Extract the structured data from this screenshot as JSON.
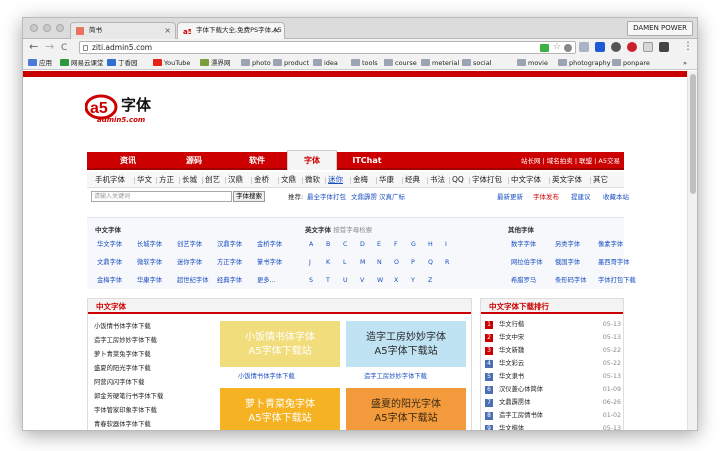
{
  "browser": {
    "tabs": [
      {
        "title": "简书",
        "close": "×"
      },
      {
        "title": "字体下载大全,免费PS字体,A5",
        "close": "×"
      }
    ],
    "profile": "DAMEN POWER",
    "nav_back": "←",
    "nav_forward": "→",
    "nav_reload": "C",
    "url": "ziti.admin5.com",
    "bookmarks": [
      "应用",
      "网易云课堂",
      "丁香园",
      "YouTube",
      "漂界网",
      "photo",
      "product",
      "idea",
      "tools",
      "course",
      "meterial",
      "social",
      "movie",
      "photography",
      "ponpare"
    ],
    "bookmarks_more": "»"
  },
  "site": {
    "logo_text": "字体",
    "logo_mark": "a5",
    "logo_domain": "admin5.com",
    "nav": [
      "资讯",
      "源码",
      "软件",
      "字体",
      "ITChat"
    ],
    "nav_active": 3,
    "nav_right": "站长网 | 域名拍卖 | 联盟 | A5交易",
    "subnav": [
      "手机字体",
      "华文",
      "方正",
      "长城",
      "创艺",
      "汉鼎",
      "金桥",
      "文鼎",
      "微软",
      "迷你",
      "金梅",
      "华康",
      "经典",
      "书法",
      "QQ",
      "字体打包",
      "中文字体",
      "英文字体",
      "其它"
    ],
    "subnav_hi": 9,
    "search_placeholder": "请输入关键词",
    "search_button": "字体搜索",
    "recommend_label": "推荐:",
    "recommend_links": [
      "最全字体打包",
      "文鼎霹雳",
      "汉真广标"
    ],
    "right_links": [
      "最新更新",
      "字体发布",
      "提建议",
      "收藏本站"
    ]
  },
  "categories": {
    "cn_title": "中文字体",
    "cn_items": [
      "华文字体",
      "长城字体",
      "创艺字体",
      "汉鼎字体",
      "金桥字体",
      "文鼎字体",
      "微软字体",
      "迷你字体",
      "方正字体",
      "篆书字体",
      "金梅字体",
      "华康字体",
      "超世纪字体",
      "经典字体",
      "更多..."
    ],
    "en_title": "英文字体",
    "en_sub": "按首字母检索",
    "en_letters": [
      "A",
      "B",
      "C",
      "D",
      "E",
      "F",
      "G",
      "H",
      "I",
      "J",
      "K",
      "L",
      "M",
      "N",
      "O",
      "P",
      "Q",
      "R",
      "S",
      "T",
      "U",
      "V",
      "W",
      "X",
      "Y",
      "Z"
    ],
    "other_title": "其他字体",
    "other_items": [
      "数字字体",
      "另类字体",
      "像素字体",
      "网拉伯字体",
      "俄国字体",
      "墨西哥字体",
      "希腊罗马",
      "条形码字体",
      "字体打包下载"
    ]
  },
  "left_panel": {
    "title": "中文字体",
    "list": [
      "小饭情书体字体下载",
      "造字工房妙妙字体下载",
      "萝卜青菜兔字体下载",
      "盛夏的阳光字体下载",
      "阿营闪闪字体下载",
      "郭金芳硬笔行书字体下载",
      "字体管家印象字体下载",
      "青春软器体字体下载",
      "玉米黑体字体下载"
    ],
    "thumbs": [
      {
        "line1": "小饭情书体字体",
        "line2": "A5字体下载站",
        "caption": "小饭情书体字体下载",
        "bg": "#f2dd7d",
        "fg": "#ffffff"
      },
      {
        "line1": "造字工房妙妙字体",
        "line2": "A5字体下载站",
        "caption": "造字工房妙妙字体下载",
        "bg": "#bfe3f2",
        "fg": "#2a2a2a"
      },
      {
        "line1": "萝卜青菜兔字体",
        "line2": "A5字体下载站",
        "caption": "",
        "bg": "#f5b324",
        "fg": "#ffffff"
      },
      {
        "line1": "盛夏的阳光字体",
        "line2": "A5字体下载站",
        "caption": "",
        "bg": "#f39a3c",
        "fg": "#3a2a10"
      }
    ]
  },
  "right_panel": {
    "title": "中文字体下载排行",
    "items": [
      {
        "rank": "1",
        "name": "华文行楷",
        "date": "05-13"
      },
      {
        "rank": "2",
        "name": "华文中宋",
        "date": "05-13"
      },
      {
        "rank": "3",
        "name": "华文新魏",
        "date": "05-22"
      },
      {
        "rank": "4",
        "name": "华文彩云",
        "date": "05-22"
      },
      {
        "rank": "5",
        "name": "华文隶书",
        "date": "05-13"
      },
      {
        "rank": "6",
        "name": "汉仪菱心体简体",
        "date": "01-09"
      },
      {
        "rank": "7",
        "name": "文鼎霹雳体",
        "date": "06-26"
      },
      {
        "rank": "8",
        "name": "造字工房情书体",
        "date": "01-02"
      },
      {
        "rank": "9",
        "name": "华文楷体",
        "date": "05-13"
      }
    ]
  },
  "colors": {
    "brand_red": "#cc0000",
    "link_blue": "#1a4fc0"
  }
}
